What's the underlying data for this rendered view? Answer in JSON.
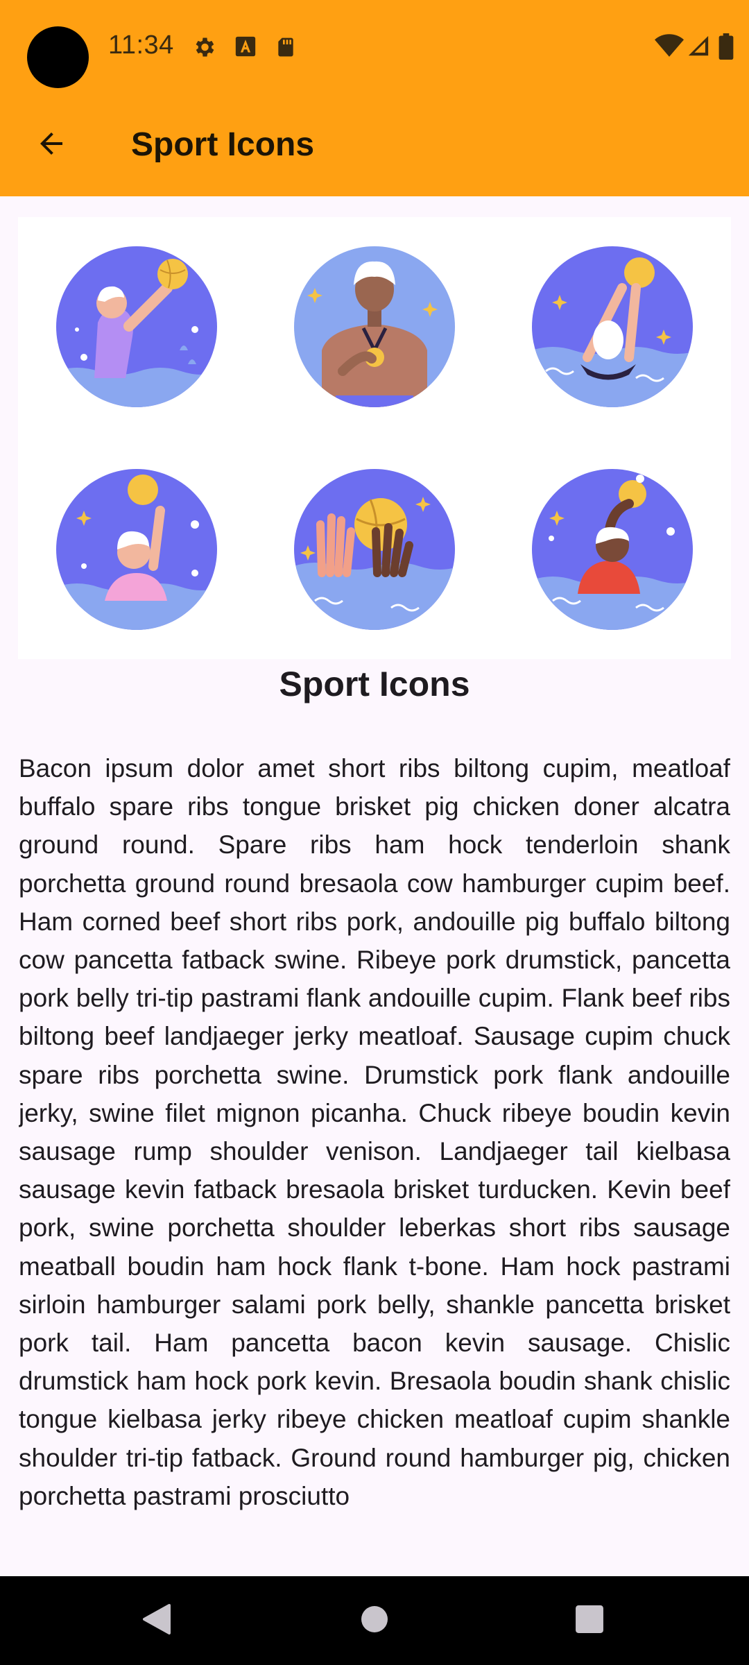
{
  "status_bar": {
    "time": "11:34",
    "left_icons": [
      "gear-icon",
      "font-a-icon",
      "sd-card-icon"
    ],
    "right_icons": [
      "wifi-icon",
      "signal-icon",
      "battery-icon"
    ]
  },
  "app_bar": {
    "title": "Sport Icons",
    "back_icon": "arrow-back-icon"
  },
  "gallery": {
    "tiles": [
      {
        "name": "swimmer-throwing-ball"
      },
      {
        "name": "player-with-medal"
      },
      {
        "name": "swimmer-diving-with-ball"
      },
      {
        "name": "swimmer-raising-ball"
      },
      {
        "name": "hands-catching-ball"
      },
      {
        "name": "player-holding-ball-overhead"
      }
    ],
    "colors": {
      "circle": "#6d6ef0",
      "water": "#8aa7f0",
      "panel": "#ffffff",
      "ball": "#f5c344"
    }
  },
  "article": {
    "title": "Sport Icons",
    "body": "Bacon ipsum dolor amet short ribs biltong cupim, meatloaf buffalo spare ribs tongue brisket pig chicken doner alcatra ground round. Spare ribs ham hock tenderloin shank porchetta ground round bresaola cow hamburger cupim beef. Ham corned beef short ribs pork, andouille pig buffalo biltong cow pancetta fatback swine. Ribeye pork drumstick, pancetta pork belly tri-tip pastrami flank andouille cupim. Flank beef ribs biltong beef landjaeger jerky meatloaf. Sausage cupim chuck spare ribs porchetta swine. Drumstick pork flank andouille jerky, swine filet mignon picanha. Chuck ribeye boudin kevin sausage rump shoulder venison. Landjaeger tail kielbasa sausage kevin fatback bresaola brisket turducken. Kevin beef pork, swine porchetta shoulder leberkas short ribs sausage meatball boudin ham hock flank t-bone. Ham hock pastrami sirloin hamburger salami pork belly, shankle pancetta brisket pork tail. Ham pancetta bacon kevin sausage. Chislic drumstick ham hock pork kevin. Bresaola boudin shank chislic tongue kielbasa jerky ribeye chicken meatloaf cupim shankle shoulder tri-tip fatback. Ground round hamburger pig, chicken porchetta pastrami prosciutto"
  },
  "nav_bar": {
    "buttons": [
      "back-triangle-icon",
      "home-circle-icon",
      "recents-square-icon"
    ]
  },
  "colors": {
    "accent": "#ffa012",
    "background": "#fdf7fe",
    "text": "#1e1b20",
    "nav_bar": "#000000"
  }
}
